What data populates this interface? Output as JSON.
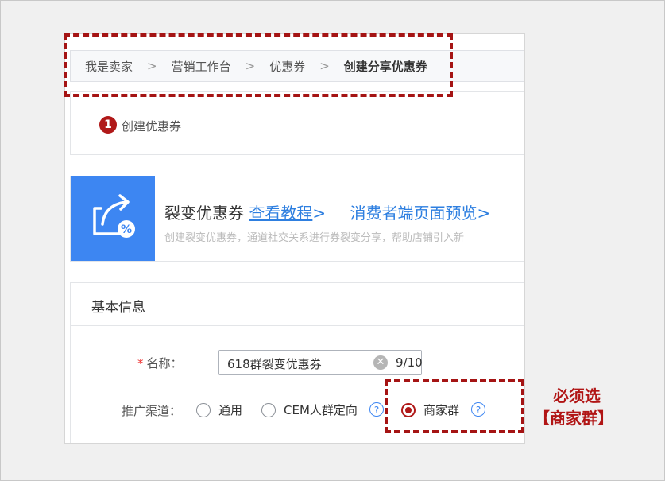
{
  "breadcrumb": {
    "items": [
      "我是卖家",
      "营销工作台",
      "优惠券"
    ],
    "current": "创建分享优惠券",
    "separator": ">"
  },
  "steps": {
    "number": "1",
    "label": "创建优惠券"
  },
  "banner": {
    "title": "裂变优惠券",
    "tutorial_link": "查看教程",
    "preview_link": "消费者端页面预览",
    "link_arrow": ">",
    "description": "创建裂变优惠券，通道社交关系进行券裂变分享，帮助店铺引入新",
    "icon": "share-coupon-icon"
  },
  "basic_info": {
    "section_title": "基本信息",
    "name_label": "名称：",
    "name_required_mark": "*",
    "name_value": "618群裂变优惠券",
    "name_count": "9/10",
    "channel_label": "推广渠道：",
    "channel_options": [
      "通用",
      "CEM人群定向",
      "商家群"
    ],
    "channel_selected": "商家群",
    "help_symbol": "?"
  },
  "annotation": {
    "line1": "必须选",
    "line2": "【商家群】"
  },
  "colors": {
    "accent_red": "#b01818",
    "link_blue": "#2e7fe0",
    "banner_blue": "#3d86f2"
  }
}
